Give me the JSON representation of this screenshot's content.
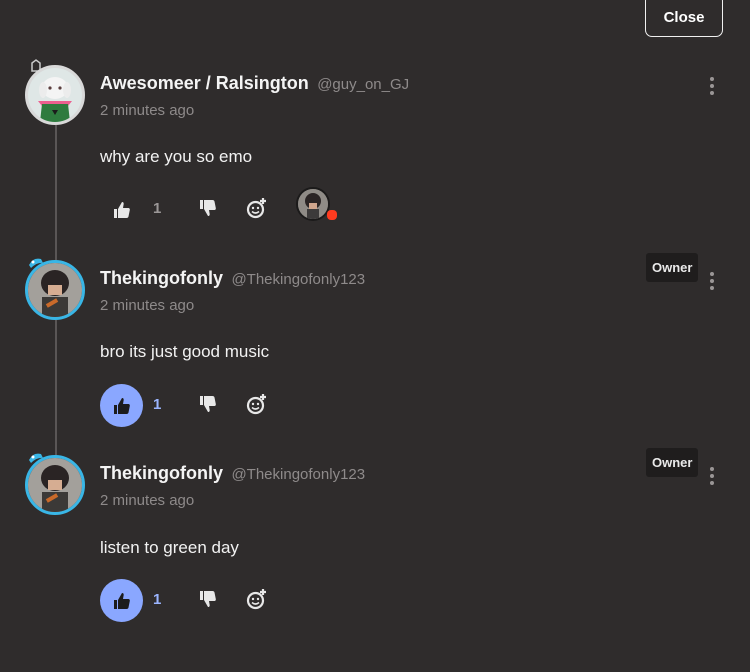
{
  "close_label": "Close",
  "comments": [
    {
      "author": "Awesomeer / Ralsington",
      "handle": "@guy_on_GJ",
      "time": "2 minutes ago",
      "body": "why are you so emo",
      "owner": "",
      "likes": "1",
      "liked": false,
      "has_reaction": true
    },
    {
      "author": "Thekingofonly",
      "handle": "@Thekingofonly123",
      "time": "2 minutes ago",
      "body": "bro its just good music",
      "owner": "Owner",
      "likes": "1",
      "liked": true,
      "has_reaction": false
    },
    {
      "author": "Thekingofonly",
      "handle": "@Thekingofonly123",
      "time": "2 minutes ago",
      "body": "listen to green day",
      "owner": "Owner",
      "likes": "1",
      "liked": true,
      "has_reaction": false
    }
  ]
}
